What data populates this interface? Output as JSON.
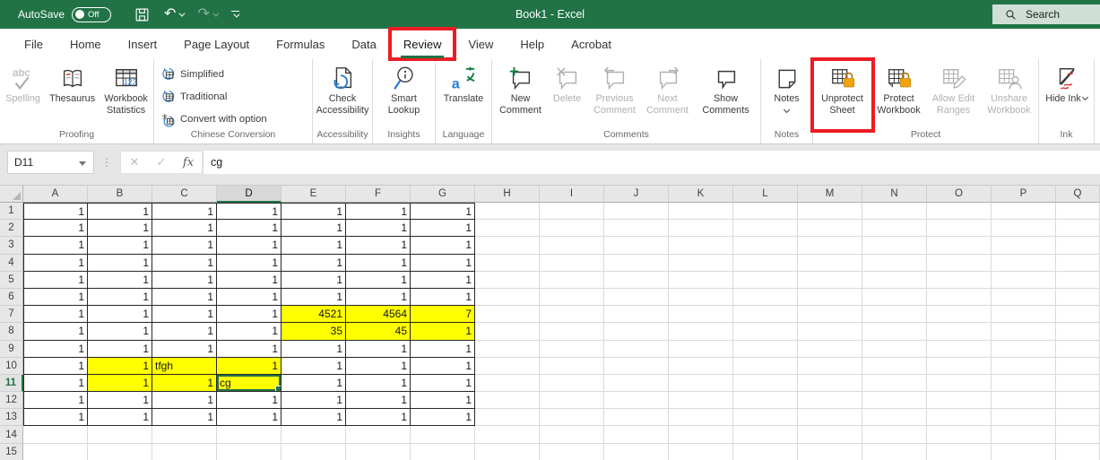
{
  "colors": {
    "accent_green": "#217346",
    "annotation_red": "#ed1c24",
    "cell_yellow": "#ffff00",
    "search_bg": "#cfdfd6",
    "lock_orange": "#f0a30a"
  },
  "titlebar": {
    "autosave_label": "AutoSave",
    "autosave_state": "Off",
    "title": "Book1  -  Excel",
    "search_label": "Search",
    "quick_access": [
      "save",
      "undo",
      "redo",
      "customize-quick-access"
    ]
  },
  "tabs": [
    {
      "label": "File",
      "active": false,
      "boxed": false
    },
    {
      "label": "Home",
      "active": false,
      "boxed": false
    },
    {
      "label": "Insert",
      "active": false,
      "boxed": false
    },
    {
      "label": "Page Layout",
      "active": false,
      "boxed": false
    },
    {
      "label": "Formulas",
      "active": false,
      "boxed": false
    },
    {
      "label": "Data",
      "active": false,
      "boxed": false
    },
    {
      "label": "Review",
      "active": true,
      "boxed": true
    },
    {
      "label": "View",
      "active": false,
      "boxed": false
    },
    {
      "label": "Help",
      "active": false,
      "boxed": false
    },
    {
      "label": "Acrobat",
      "active": false,
      "boxed": false
    }
  ],
  "ribbon": {
    "groups": [
      {
        "name": "Proofing",
        "stack": false,
        "buttons": [
          {
            "label": "Spelling",
            "icon": "spelling",
            "disabled": true
          },
          {
            "label": "Thesaurus",
            "icon": "thesaurus",
            "disabled": false
          },
          {
            "label": "Workbook Statistics",
            "icon": "workbook-statistics",
            "disabled": false
          }
        ]
      },
      {
        "name": "Chinese Conversion",
        "stack": true,
        "buttons": [
          {
            "label": "Simplified",
            "icon": "simplified",
            "disabled": false
          },
          {
            "label": "Traditional",
            "icon": "traditional",
            "disabled": false
          },
          {
            "label": "Convert with option",
            "icon": "convert-with-option",
            "disabled": false
          }
        ]
      },
      {
        "name": "Accessibility",
        "stack": false,
        "buttons": [
          {
            "label": "Check Accessibility",
            "icon": "check-accessibility",
            "disabled": false
          }
        ]
      },
      {
        "name": "Insights",
        "stack": false,
        "buttons": [
          {
            "label": "Smart Lookup",
            "icon": "smart-lookup",
            "disabled": false
          }
        ]
      },
      {
        "name": "Language",
        "stack": false,
        "buttons": [
          {
            "label": "Translate",
            "icon": "translate",
            "disabled": false
          }
        ]
      },
      {
        "name": "Comments",
        "stack": false,
        "buttons": [
          {
            "label": "New Comment",
            "icon": "new-comment",
            "disabled": false
          },
          {
            "label": "Delete",
            "icon": "delete-comment",
            "disabled": true
          },
          {
            "label": "Previous Comment",
            "icon": "previous-comment",
            "disabled": true
          },
          {
            "label": "Next Comment",
            "icon": "next-comment",
            "disabled": true
          },
          {
            "label": "Show Comments",
            "icon": "show-comments",
            "disabled": false
          }
        ]
      },
      {
        "name": "Notes",
        "stack": false,
        "buttons": [
          {
            "label": "Notes",
            "icon": "notes",
            "disabled": false,
            "dropdown": "below"
          }
        ]
      },
      {
        "name": "Protect",
        "stack": false,
        "buttons": [
          {
            "label": "Unprotect Sheet",
            "icon": "unprotect-sheet",
            "disabled": false,
            "boxed": true
          },
          {
            "label": "Protect Workbook",
            "icon": "protect-workbook",
            "disabled": false
          },
          {
            "label": "Allow Edit Ranges",
            "icon": "allow-edit-ranges",
            "disabled": true
          },
          {
            "label": "Unshare Workbook",
            "icon": "unshare-workbook",
            "disabled": true
          }
        ]
      },
      {
        "name": "Ink",
        "stack": false,
        "buttons": [
          {
            "label": "Hide Ink",
            "icon": "hide-ink",
            "disabled": false,
            "dropdown": "inline"
          }
        ]
      }
    ]
  },
  "formula_bar": {
    "name_box": "D11",
    "cancel_icon": "✕",
    "enter_icon": "✓",
    "fx_label": "fx",
    "content": "cg"
  },
  "sheet": {
    "columns": [
      "A",
      "B",
      "C",
      "D",
      "E",
      "F",
      "G",
      "H",
      "I",
      "J",
      "K",
      "L",
      "M",
      "N",
      "O",
      "P",
      "Q"
    ],
    "visible_rows": 15,
    "selected_cell": "D11",
    "selected_column": "D",
    "selected_row": 11,
    "data_rows": [
      [
        "1",
        "1",
        "1",
        "1",
        "1",
        "1",
        "1"
      ],
      [
        "1",
        "1",
        "1",
        "1",
        "1",
        "1",
        "1"
      ],
      [
        "1",
        "1",
        "1",
        "1",
        "1",
        "1",
        "1"
      ],
      [
        "1",
        "1",
        "1",
        "1",
        "1",
        "1",
        "1"
      ],
      [
        "1",
        "1",
        "1",
        "1",
        "1",
        "1",
        "1"
      ],
      [
        "1",
        "1",
        "1",
        "1",
        "1",
        "1",
        "1"
      ],
      [
        "1",
        "1",
        "1",
        "1",
        "4521",
        "4564",
        "7"
      ],
      [
        "1",
        "1",
        "1",
        "1",
        "35",
        "45",
        "1"
      ],
      [
        "1",
        "1",
        "1",
        "1",
        "1",
        "1",
        "1"
      ],
      [
        "1",
        "1",
        "tfgh",
        "1",
        "1",
        "1",
        "1"
      ],
      [
        "1",
        "1",
        "1",
        "cg",
        "1",
        "1",
        "1"
      ],
      [
        "1",
        "1",
        "1",
        "1",
        "1",
        "1",
        "1"
      ],
      [
        "1",
        "1",
        "1",
        "1",
        "1",
        "1",
        "1"
      ]
    ],
    "yellow_cells": [
      "E7",
      "F7",
      "G7",
      "E8",
      "F8",
      "G8",
      "B10",
      "C10",
      "D10",
      "B11",
      "C11",
      "D11"
    ],
    "text_cells": [
      "C10",
      "D11"
    ]
  }
}
